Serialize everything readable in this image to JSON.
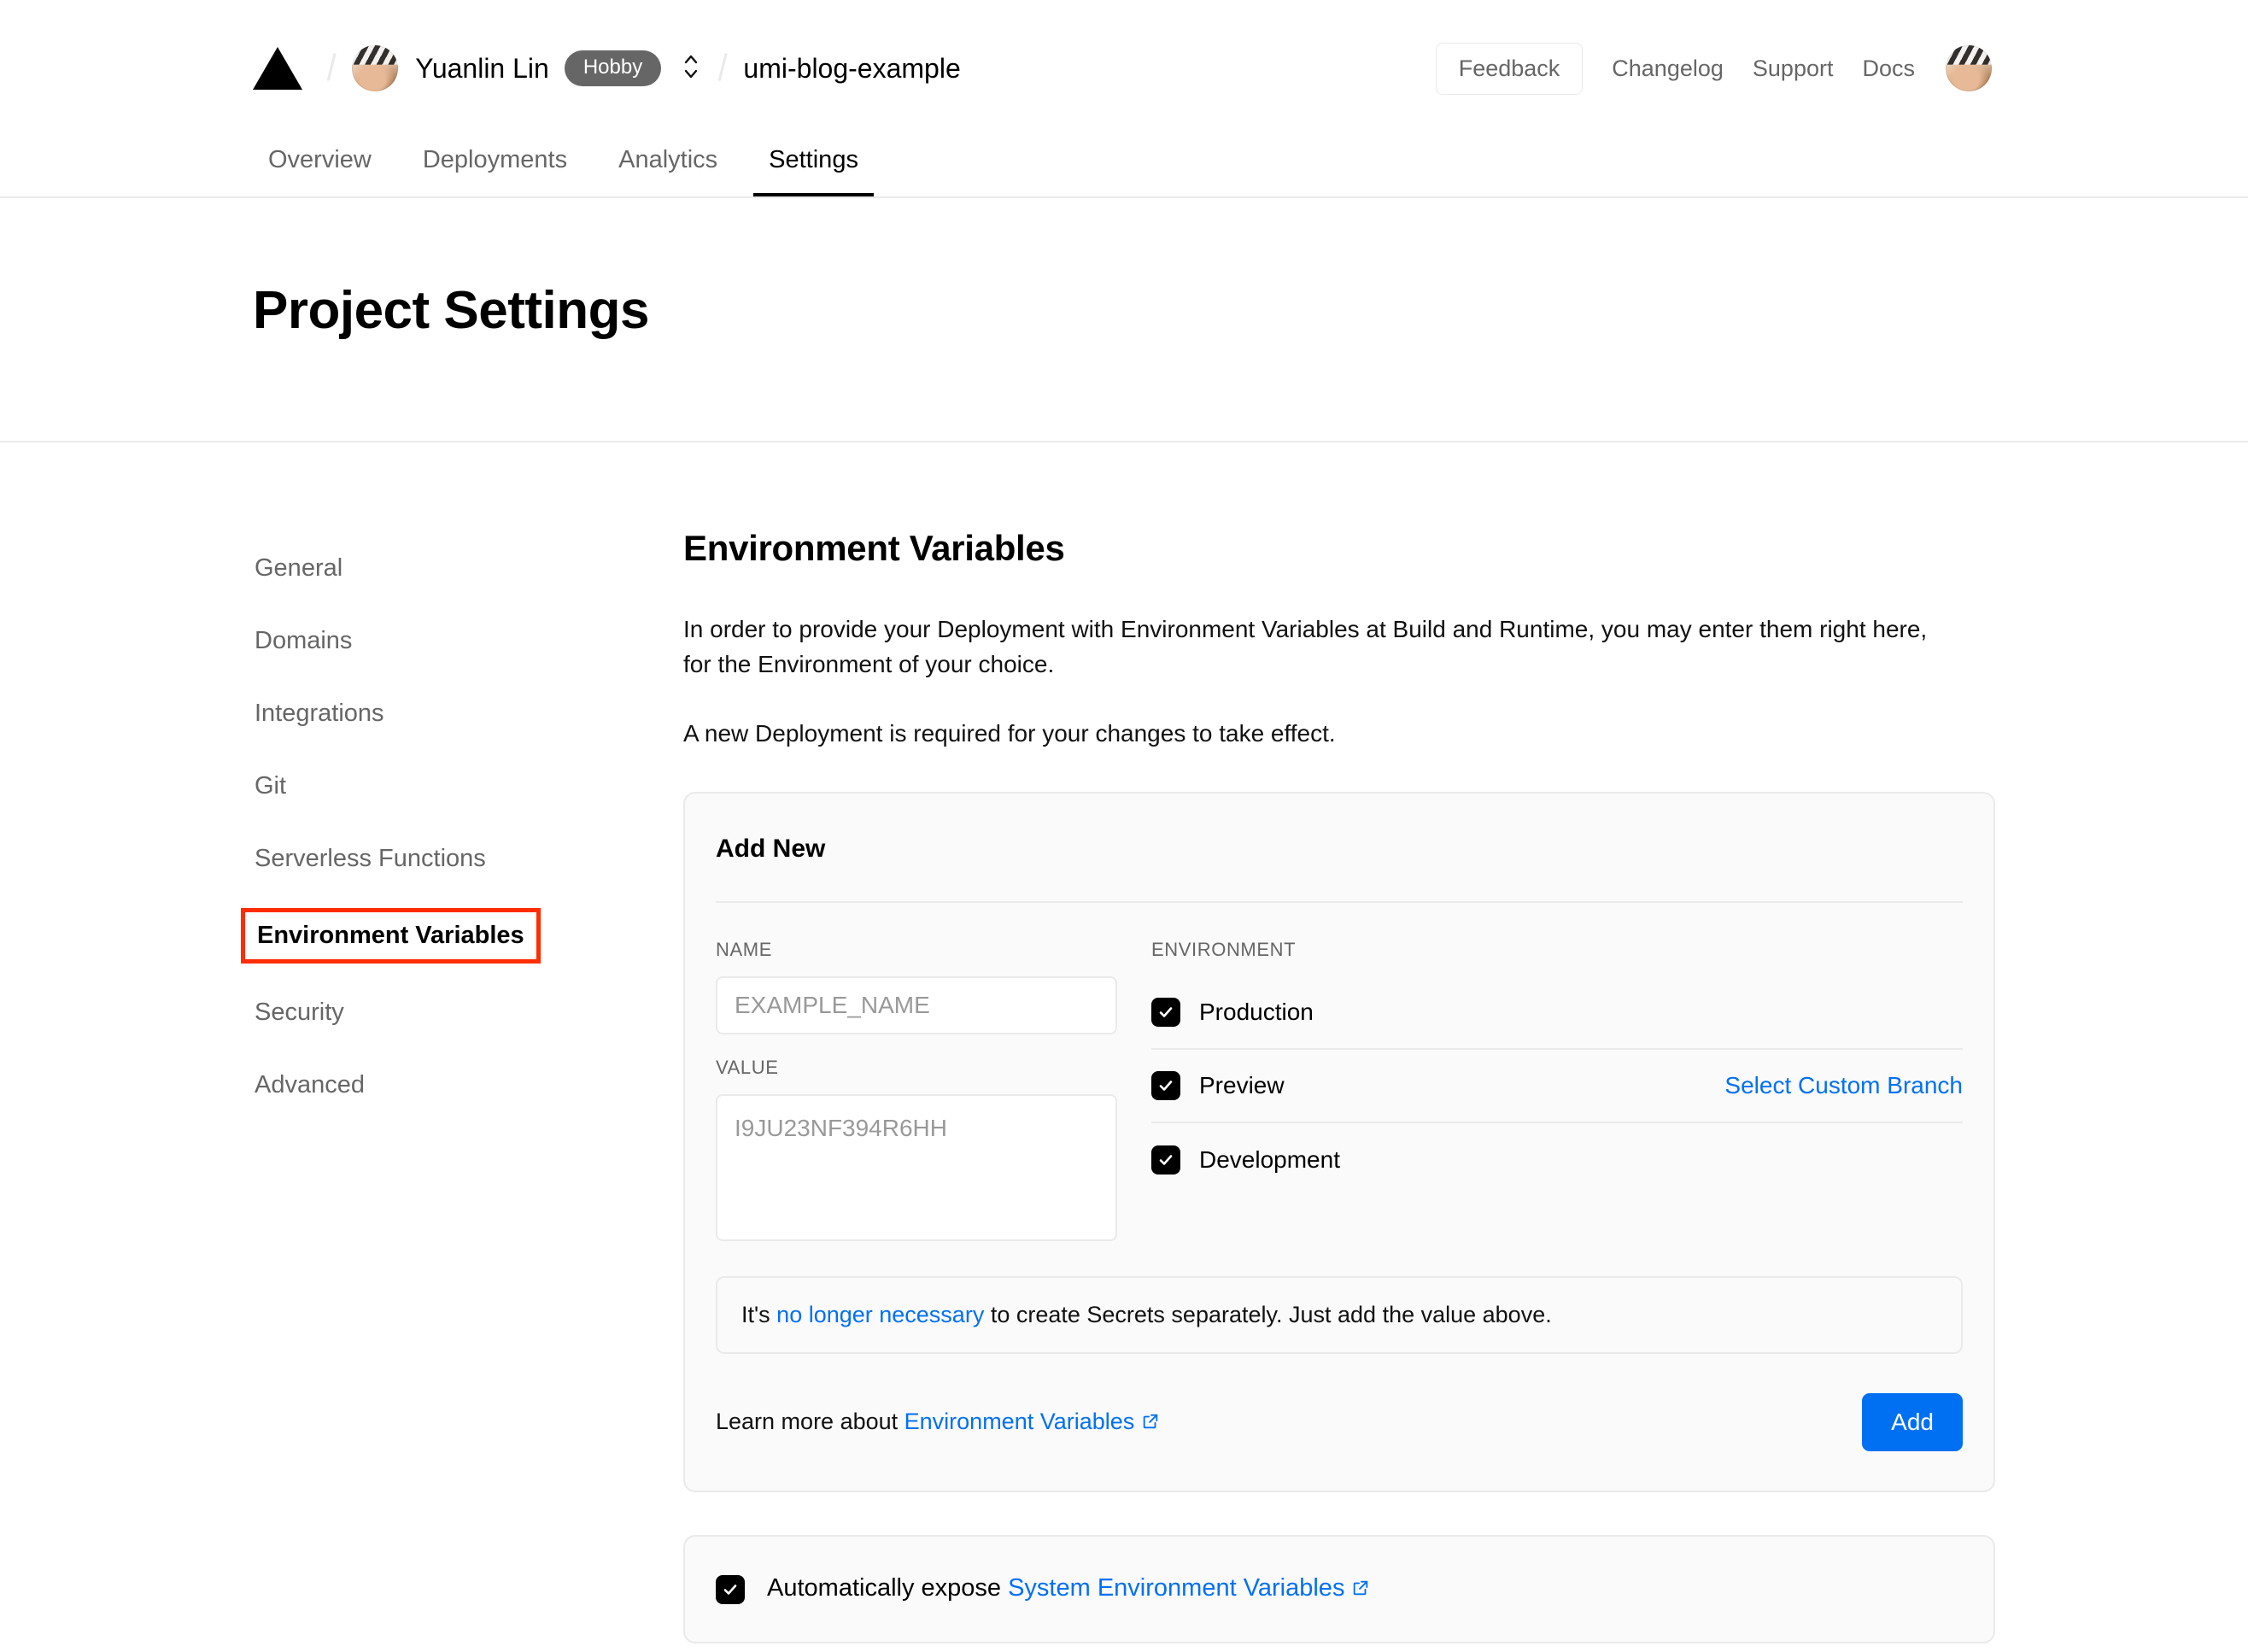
{
  "header": {
    "logo_icon": "vercel-triangle-logo",
    "user_avatar_icon": "user-avatar",
    "user_name": "Yuanlin Lin",
    "plan_badge": "Hobby",
    "scope_selector_icon": "chevron-up-down-icon",
    "project_name": "umi-blog-example",
    "separator": "/",
    "feedback_label": "Feedback",
    "links": [
      {
        "label": "Changelog"
      },
      {
        "label": "Support"
      },
      {
        "label": "Docs"
      }
    ],
    "account_avatar_icon": "account-avatar"
  },
  "tabs": [
    {
      "label": "Overview",
      "active": false
    },
    {
      "label": "Deployments",
      "active": false
    },
    {
      "label": "Analytics",
      "active": false
    },
    {
      "label": "Settings",
      "active": true
    }
  ],
  "page": {
    "title": "Project Settings"
  },
  "sidebar": {
    "items": [
      {
        "label": "General"
      },
      {
        "label": "Domains"
      },
      {
        "label": "Integrations"
      },
      {
        "label": "Git"
      },
      {
        "label": "Serverless Functions"
      },
      {
        "label": "Environment Variables"
      },
      {
        "label": "Security"
      },
      {
        "label": "Advanced"
      }
    ]
  },
  "main": {
    "heading": "Environment Variables",
    "paragraph_1": "In order to provide your Deployment with Environment Variables at Build and Runtime, you may enter them right here, for the Environment of your choice.",
    "paragraph_2": "A new Deployment is required for your changes to take effect.",
    "card": {
      "title": "Add New",
      "name_label": "NAME",
      "name_placeholder": "EXAMPLE_NAME",
      "name_value": "",
      "value_label": "VALUE",
      "value_placeholder": "I9JU23NF394R6HH",
      "value_value": "",
      "environment_label": "ENVIRONMENT",
      "environments": [
        {
          "label": "Production",
          "checked": true
        },
        {
          "label": "Preview",
          "checked": true
        },
        {
          "label": "Development",
          "checked": true
        }
      ],
      "custom_branch_link": "Select Custom Branch",
      "notice_prefix": "It's ",
      "notice_link": "no longer necessary",
      "notice_suffix": " to create Secrets separately. Just add the value above.",
      "learn_more_prefix": "Learn more about ",
      "learn_more_link": "Environment Variables",
      "external_link_icon": "external-link-icon",
      "add_button": "Add"
    },
    "expose": {
      "checked": true,
      "prefix": "Automatically expose ",
      "link": "System Environment Variables",
      "external_link_icon": "external-link-icon"
    }
  },
  "annotation": {
    "target": "Environment Variables",
    "color": "#ff2d00"
  },
  "colors": {
    "accent_blue": "#0070f3",
    "border": "#eaeaea",
    "card_bg": "#fafafa",
    "muted_text": "#666666"
  }
}
